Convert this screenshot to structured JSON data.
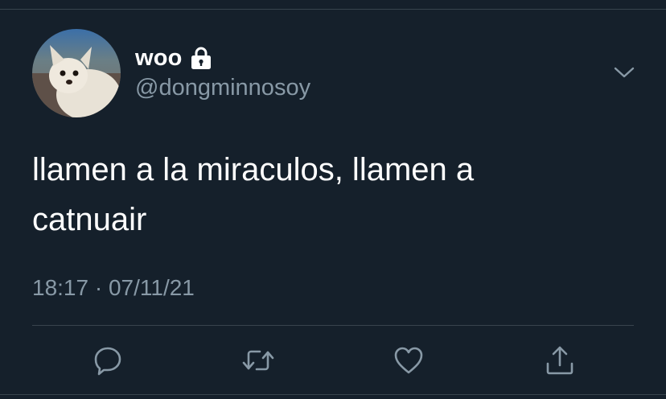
{
  "tweet": {
    "display_name": "woo",
    "handle": "@dongminnosoy",
    "protected_icon": "lock-icon",
    "text": "llamen a la miraculos, llamen a\ncatnuair",
    "time": "18:17",
    "separator": "·",
    "date": "07/11/21",
    "timestamp": "18:17 · 07/11/21",
    "menu_icon": "chevron-down-icon"
  },
  "actions": [
    {
      "name": "reply",
      "icon": "reply-icon"
    },
    {
      "name": "retweet",
      "icon": "retweet-icon"
    },
    {
      "name": "like",
      "icon": "heart-icon"
    },
    {
      "name": "share",
      "icon": "share-icon"
    }
  ],
  "colors": {
    "background": "#15202b",
    "primary_text": "#ffffff",
    "secondary_text": "#8899a6",
    "divider": "#38444d"
  }
}
